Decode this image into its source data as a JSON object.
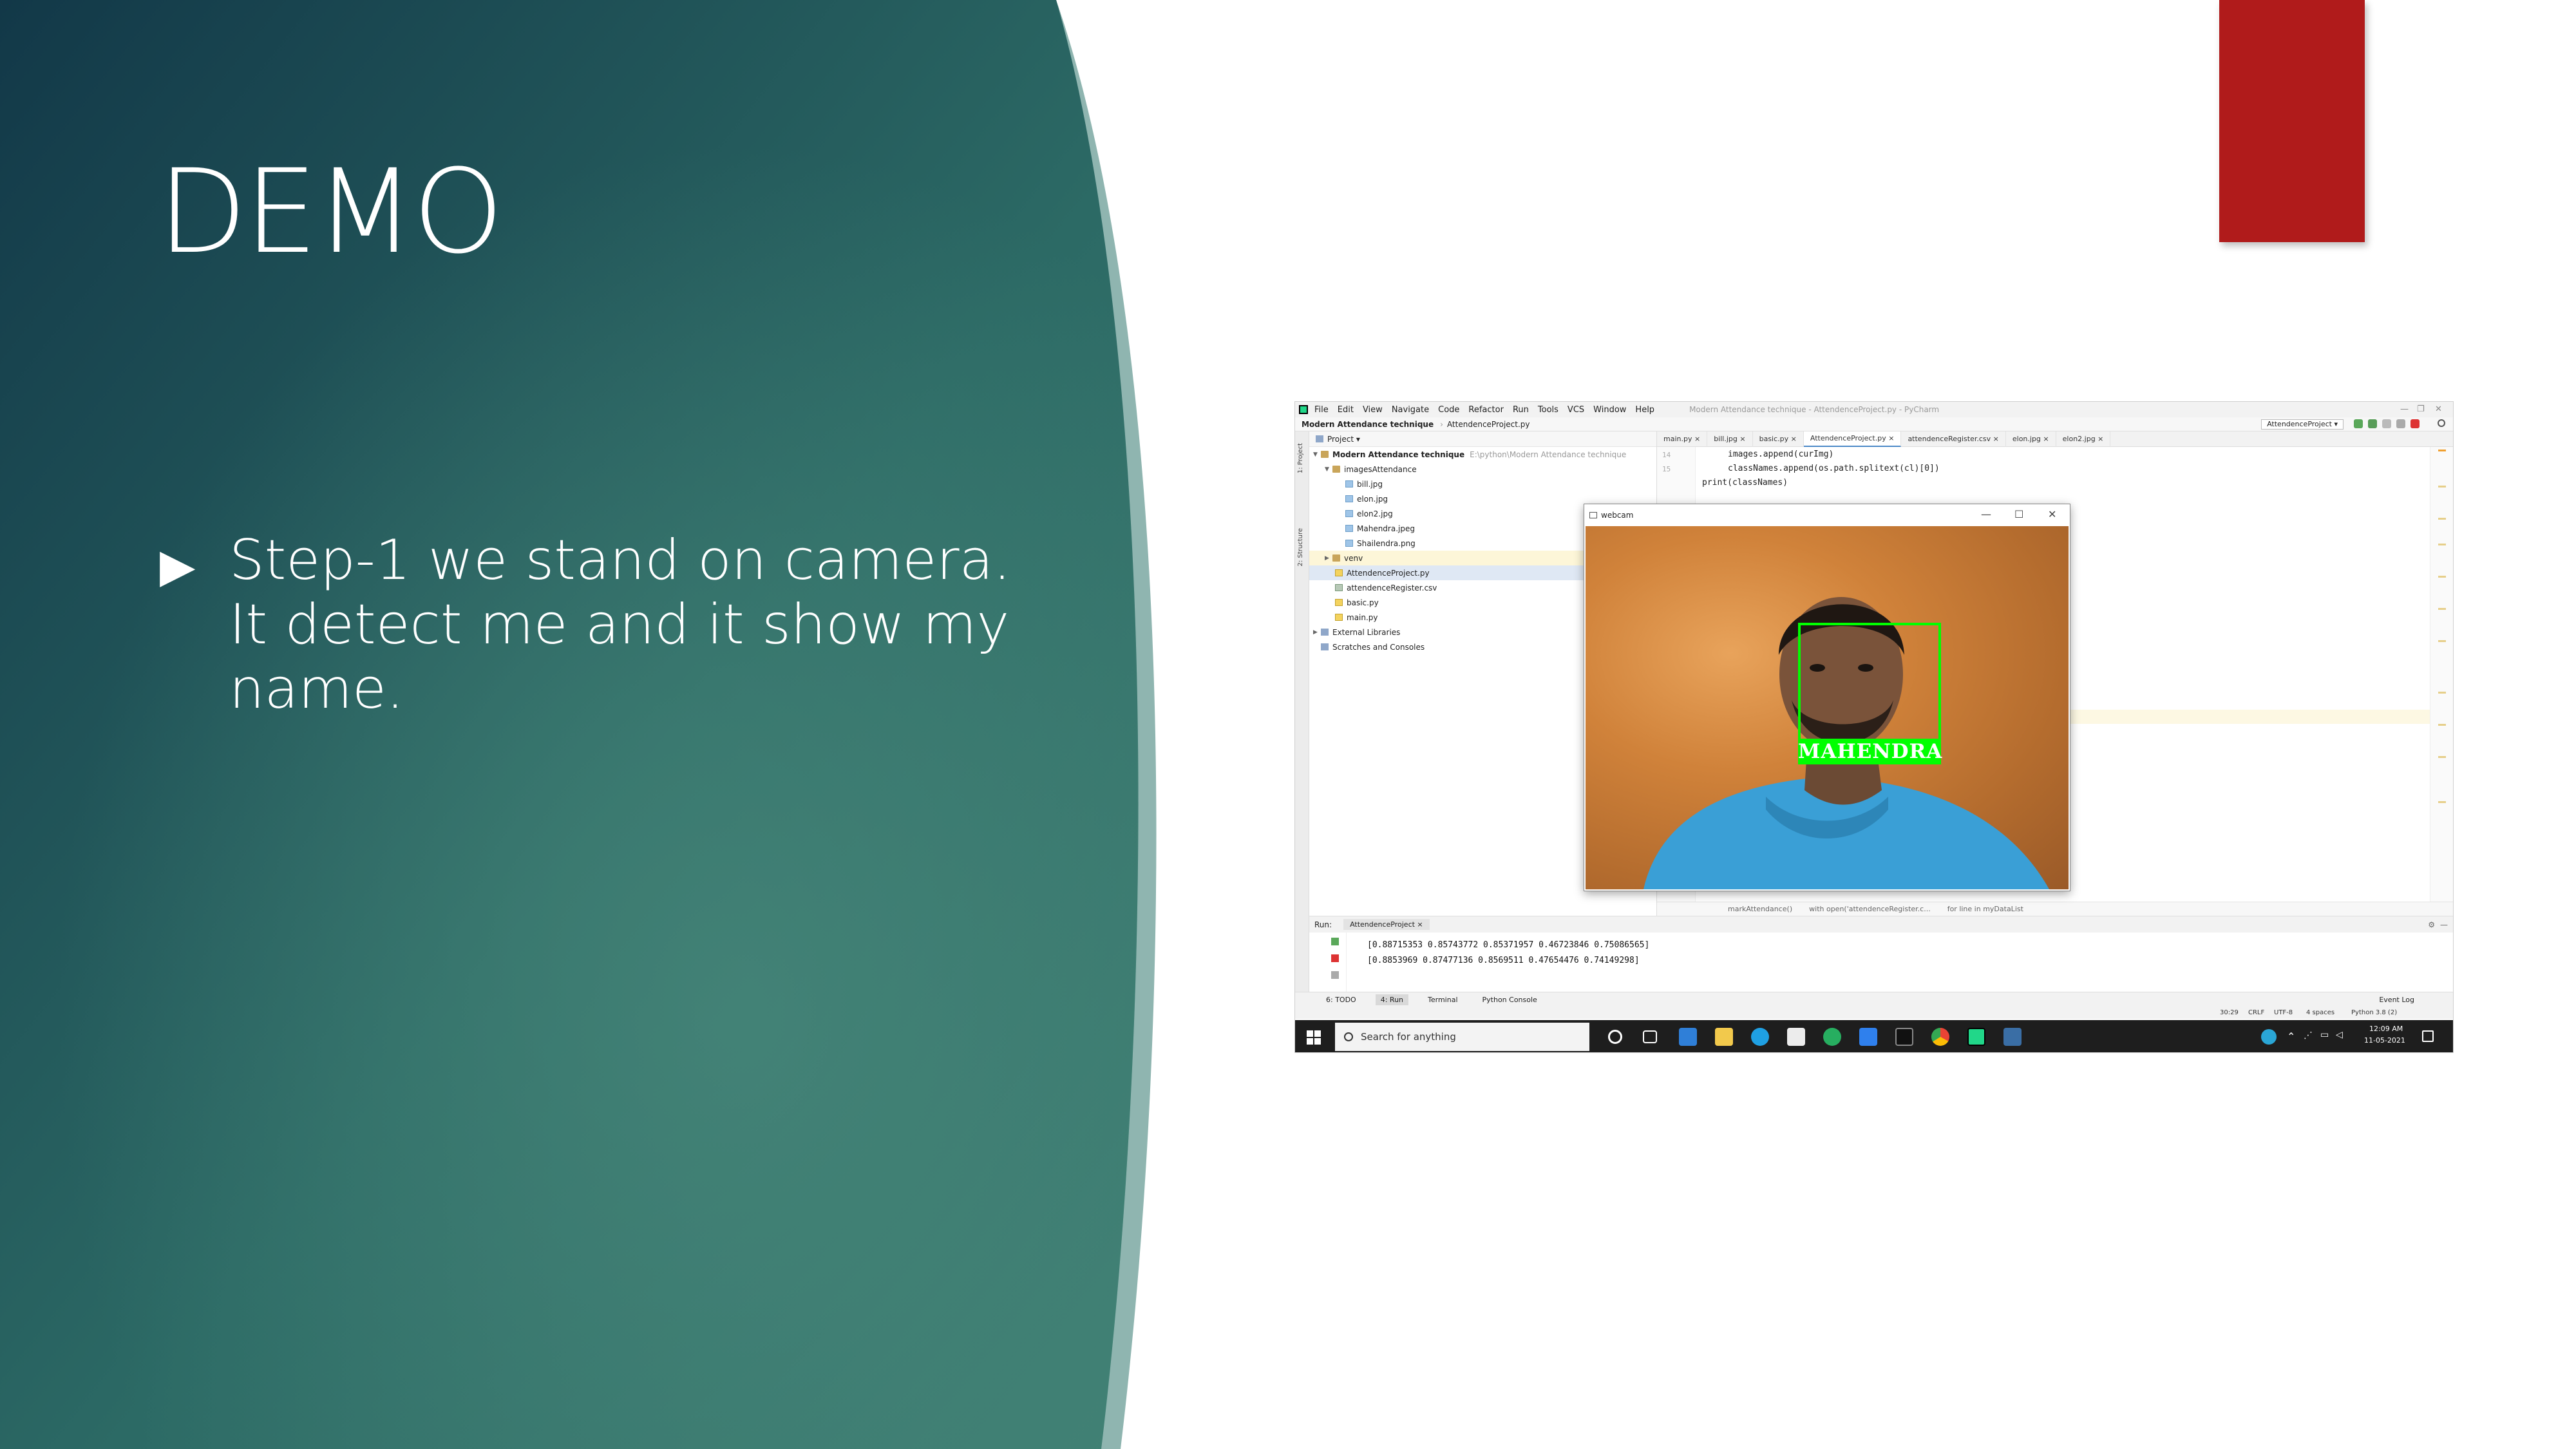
{
  "slide": {
    "title": "DEMO",
    "bullet_symbol": "▶",
    "bullet_text": "Step-1 we stand on camera. It detect me and it show my name.",
    "colors": {
      "panel_dark": "#163e47",
      "panel_light": "#3e7d72",
      "accent_red": "#b01b1b"
    }
  },
  "ide": {
    "menu": [
      "File",
      "Edit",
      "View",
      "Navigate",
      "Code",
      "Refactor",
      "Run",
      "Tools",
      "VCS",
      "Window",
      "Help"
    ],
    "window_title": "Modern Attendance technique - AttendenceProject.py - PyCharm",
    "nav_project": "Modern Attendance technique",
    "nav_file": "AttendenceProject.py",
    "run_config": "AttendenceProject",
    "project_header": "Project",
    "tree": {
      "root": "Modern Attendance technique",
      "root_path": "E:\\python\\Modern Attendance technique",
      "images_folder": "imagesAttendance",
      "files_images": [
        "bill.jpg",
        "elon.jpg",
        "elon2.jpg",
        "Mahendra.jpeg",
        "Shailendra.png"
      ],
      "venv": "venv",
      "files_root": [
        "AttendenceProject.py",
        "attendenceRegister.csv",
        "basic.py",
        "main.py"
      ],
      "external": "External Libraries",
      "scratches": "Scratches and Consoles"
    },
    "tabs": [
      "main.py",
      "bill.jpg",
      "basic.py",
      "AttendenceProject.py",
      "attendenceRegister.csv",
      "elon.jpg",
      "elon2.jpg"
    ],
    "code": {
      "line_numbers": [
        "14",
        "15"
      ],
      "lines": [
        "images.append(curImg)",
        "classNames.append(os.path.splitext(cl)[0])",
        "print(classNames)"
      ]
    },
    "breadcrumb": [
      "markAttendance()",
      "with open('attendenceRegister.c...",
      "for line in myDataList"
    ],
    "left_strip": [
      "1: Project",
      "2: Structure"
    ],
    "webcam": {
      "title": "webcam",
      "detected_name": "MAHENDRA",
      "controls": [
        "—",
        "☐",
        "✕"
      ]
    },
    "run": {
      "label": "Run:",
      "tab": "AttendenceProject",
      "output": [
        "[0.88715353  0.85743772  0.85371957  0.46723846  0.75086565]",
        "[0.8853969   0.87477136  0.8569511   0.47654476  0.74149298]"
      ]
    },
    "bottom_tools": [
      "6: TODO",
      "4: Run",
      "Terminal",
      "Python Console"
    ],
    "event_log": "Event Log",
    "status": {
      "position": "30:29",
      "line_sep": "CRLF",
      "encoding": "UTF-8",
      "indent": "4 spaces",
      "interpreter": "Python 3.8 (2)"
    },
    "taskbar": {
      "search_placeholder": "Search for anything",
      "time": "12:09 AM",
      "date": "11-05-2021"
    }
  }
}
